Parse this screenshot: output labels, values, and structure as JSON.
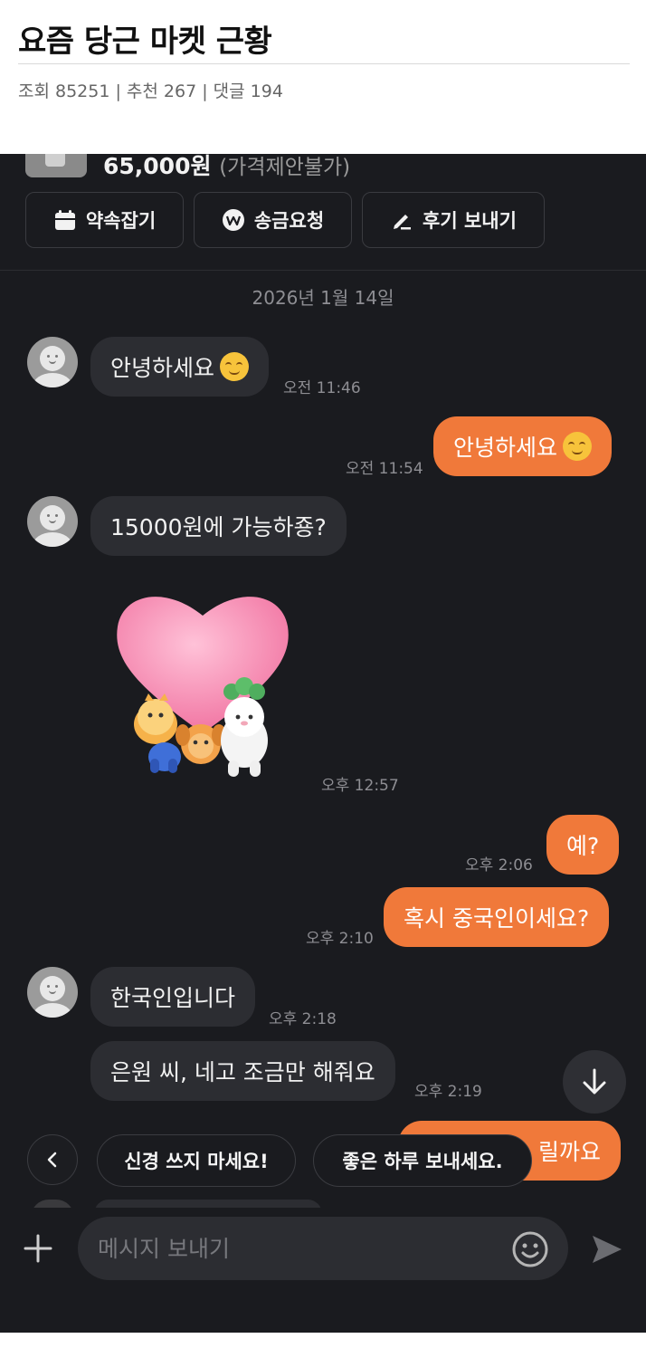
{
  "post": {
    "title": "요즘 당근 마켓 근황",
    "meta": "조회 85251 | 추천 267 | 댓글 194"
  },
  "product": {
    "price": "65,000원",
    "price_note": "(가격제안불가)"
  },
  "actions": [
    {
      "label": "약속잡기",
      "icon": "calendar-icon"
    },
    {
      "label": "송금요청",
      "icon": "won-circle-icon"
    },
    {
      "label": "후기 보내기",
      "icon": "pencil-icon"
    }
  ],
  "date_separator": "2026년 1월 14일",
  "messages": [
    {
      "side": "in",
      "text": "안녕하세요",
      "emoji": "smiling-face",
      "time": "오전 11:46"
    },
    {
      "side": "out",
      "text": "안녕하세요",
      "emoji": "smiling-face",
      "time": "오전 11:54"
    },
    {
      "side": "in",
      "text": "15000원에 가능하죵?",
      "time": ""
    },
    {
      "side": "in",
      "sticker": "heart-with-animals-sticker",
      "time": "오후 12:57"
    },
    {
      "side": "out",
      "text": "예?",
      "time": "오후 2:06"
    },
    {
      "side": "out",
      "text": "혹시 중국인이세요?",
      "time": "오후 2:10"
    },
    {
      "side": "in",
      "text": "한국인입니다",
      "time": "오후 2:18"
    },
    {
      "side": "in",
      "text": "은원 씨, 네고 조금만 해줘요",
      "time": "오후 2:19"
    },
    {
      "side": "out",
      "text": "릴까요",
      "partial": true,
      "time": ""
    }
  ],
  "quick_replies": [
    "신경 쓰지 마세요!",
    "좋은 하루 보내세요."
  ],
  "input": {
    "placeholder": "메시지 보내기"
  },
  "colors": {
    "chat_background": "#1a1b1f",
    "incoming_bubble": "#2c2d32",
    "outgoing_bubble": "#f0793a"
  }
}
